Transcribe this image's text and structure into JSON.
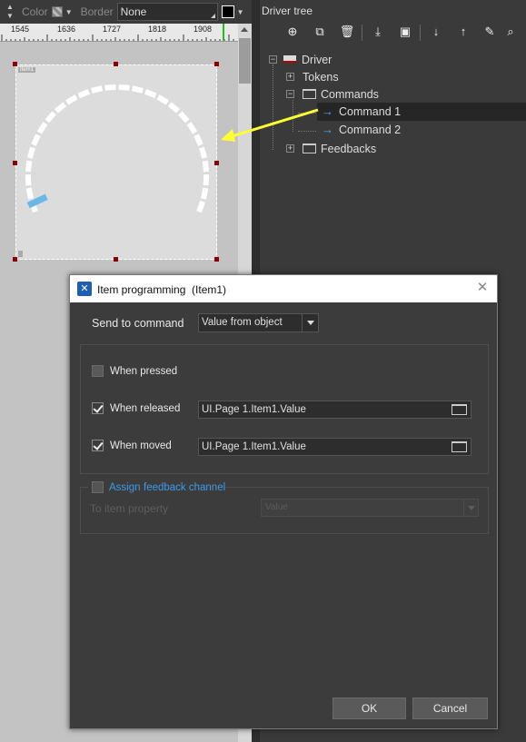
{
  "toolbar": {
    "color_label": "Color",
    "border_label": "Border",
    "border_value": "None"
  },
  "ruler": {
    "labels": [
      "1545",
      "1636",
      "1727",
      "1818",
      "1908"
    ]
  },
  "driver_tree": {
    "title": "Driver tree",
    "tools": [
      "add-icon",
      "duplicate-icon",
      "delete-icon",
      "import-icon",
      "device-icon",
      "move-down-icon",
      "move-up-icon",
      "clean-icon",
      "search-icon"
    ],
    "nodes": {
      "driver": "Driver",
      "tokens": "Tokens",
      "commands": "Commands",
      "command1": "Command 1",
      "command2": "Command 2",
      "feedbacks": "Feedbacks"
    }
  },
  "dialog": {
    "title": "Item programming  (Item1)",
    "send_to_command_label": "Send to command",
    "send_to_command_value": "Value from object",
    "when_pressed": {
      "label": "When pressed",
      "checked": false
    },
    "when_released": {
      "label": "When released",
      "checked": true,
      "value": "UI.Page 1.Item1.Value"
    },
    "when_moved": {
      "label": "When moved",
      "checked": true,
      "value": "UI.Page 1.Item1.Value"
    },
    "assign_link": "Assign",
    "feedback_link": "feedback channel",
    "to_item_property_label": "To item property",
    "to_item_property_value": "Value",
    "ok_label": "OK",
    "cancel_label": "Cancel"
  },
  "colors": {
    "accent_link": "#3d9be9",
    "command_arrow": "#4aa8ff",
    "highlight_arrow": "#ffff33",
    "gauge_indicator": "#6bb8e8"
  }
}
